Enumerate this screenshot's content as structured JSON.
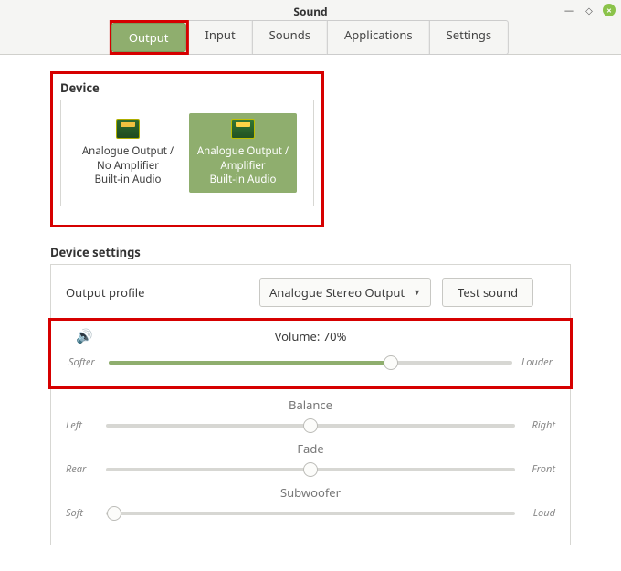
{
  "window": {
    "title": "Sound"
  },
  "tabs": {
    "output": "Output",
    "input": "Input",
    "sounds": "Sounds",
    "applications": "Applications",
    "settings": "Settings"
  },
  "device": {
    "label": "Device",
    "cards": [
      {
        "line1": "Analogue Output /",
        "line2": "No Amplifier",
        "line3": "Built-in Audio"
      },
      {
        "line1": "Analogue Output /",
        "line2": "Amplifier",
        "line3": "Built-in Audio"
      }
    ]
  },
  "settings": {
    "label": "Device settings",
    "profile_label": "Output profile",
    "profile_value": "Analogue Stereo Output",
    "test_btn": "Test sound",
    "volume_label": "Volume: 70%",
    "volume_pct": 70,
    "softer": "Softer",
    "louder": "Louder",
    "balance_label": "Balance",
    "balance_pct": 50,
    "left": "Left",
    "right": "Right",
    "fade_label": "Fade",
    "fade_pct": 50,
    "rear": "Rear",
    "front": "Front",
    "subwoofer_label": "Subwoofer",
    "subwoofer_pct": 2,
    "soft": "Soft",
    "loud": "Loud"
  }
}
